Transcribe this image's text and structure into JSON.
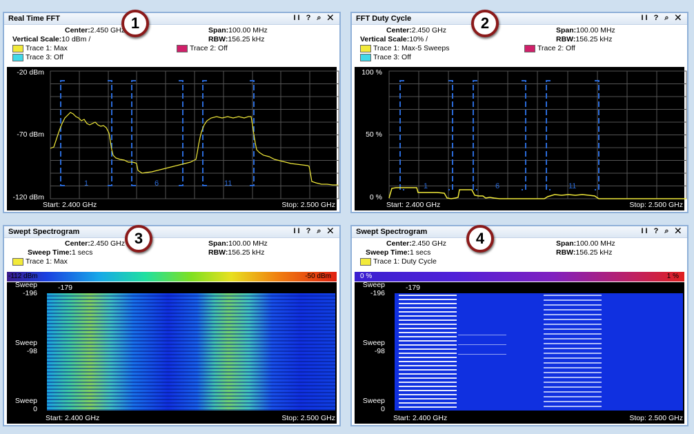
{
  "panels": [
    {
      "title": "Real Time FFT",
      "badge": "1",
      "controls": "II ? ⌕ ✕",
      "center_label": "Center:",
      "center": "2.450 GHz",
      "span_label": "Span:",
      "span": "100.00 MHz",
      "row2_label": "Vertical Scale:",
      "row2": "10 dBm /",
      "rbw_label": "RBW:",
      "rbw": "156.25 kHz",
      "trace1": "Trace 1: Max",
      "trace2": "Trace 2: Off",
      "trace3": "Trace 3: Off",
      "y_top": "-20 dBm",
      "y_mid": "-70 dBm",
      "y_bot": "-120 dBm",
      "start": "Start: 2.400 GHz",
      "stop": "Stop: 2.500 GHz",
      "channels": [
        "1",
        "6",
        "11"
      ]
    },
    {
      "title": "FFT Duty Cycle",
      "badge": "2",
      "controls": "II ? ⌕ ✕",
      "center_label": "Center:",
      "center": "2.450 GHz",
      "span_label": "Span:",
      "span": "100.00 MHz",
      "row2_label": "Vertical Scale:",
      "row2": "10% /",
      "rbw_label": "RBW:",
      "rbw": "156.25 kHz",
      "trace1": "Trace 1: Max-5 Sweeps",
      "trace2": "Trace 2: Off",
      "trace3": "Trace 3: Off",
      "y_top": "100 %",
      "y_mid": "50 %",
      "y_bot": "0 %",
      "start": "Start: 2.400 GHz",
      "stop": "Stop: 2.500 GHz",
      "channels": [
        "1",
        "6",
        "11"
      ]
    },
    {
      "title": "Swept Spectrogram",
      "badge": "3",
      "controls": "II ? ⌕ ✕",
      "center_label": "Center:",
      "center": "2.450 GHz",
      "span_label": "Span:",
      "span": "100.00 MHz",
      "row2_label": "Sweep Time:",
      "row2": "1 secs",
      "rbw_label": "RBW:",
      "rbw": "156.25 kHz",
      "trace1": "Trace 1: Max",
      "cb_left": "-112 dBm",
      "cb_right": "-50 dBm",
      "marker": "-179",
      "sweep_label": "Sweep",
      "sweep_top": "-196",
      "sweep_mid": "-98",
      "sweep_bot": "0",
      "start": "Start: 2.400 GHz",
      "stop": "Stop: 2.500 GHz"
    },
    {
      "title": "Swept Spectrogram",
      "badge": "4",
      "controls": "II ? ⌕ ✕",
      "center_label": "Center:",
      "center": "2.450 GHz",
      "span_label": "Span:",
      "span": "100.00 MHz",
      "row2_label": "Sweep Time:",
      "row2": "1 secs",
      "rbw_label": "RBW:",
      "rbw": "156.25 kHz",
      "trace1": "Trace 1: Duty Cycle",
      "cb_left": "0 %",
      "cb_right": "1 %",
      "marker": "-179",
      "sweep_label": "Sweep",
      "sweep_top": "-196",
      "sweep_mid": "-98",
      "sweep_bot": "0",
      "start": "Start: 2.400 GHz",
      "stop": "Stop: 2.500 GHz"
    }
  ],
  "colors": {
    "trace1": "#f2ea3a",
    "trace2": "#d0206a",
    "trace3": "#40d8e8",
    "channel_marker": "#2a6ad8",
    "badge_ring": "#8b1a1a",
    "spectrogram_bg": "#1030e0"
  }
}
